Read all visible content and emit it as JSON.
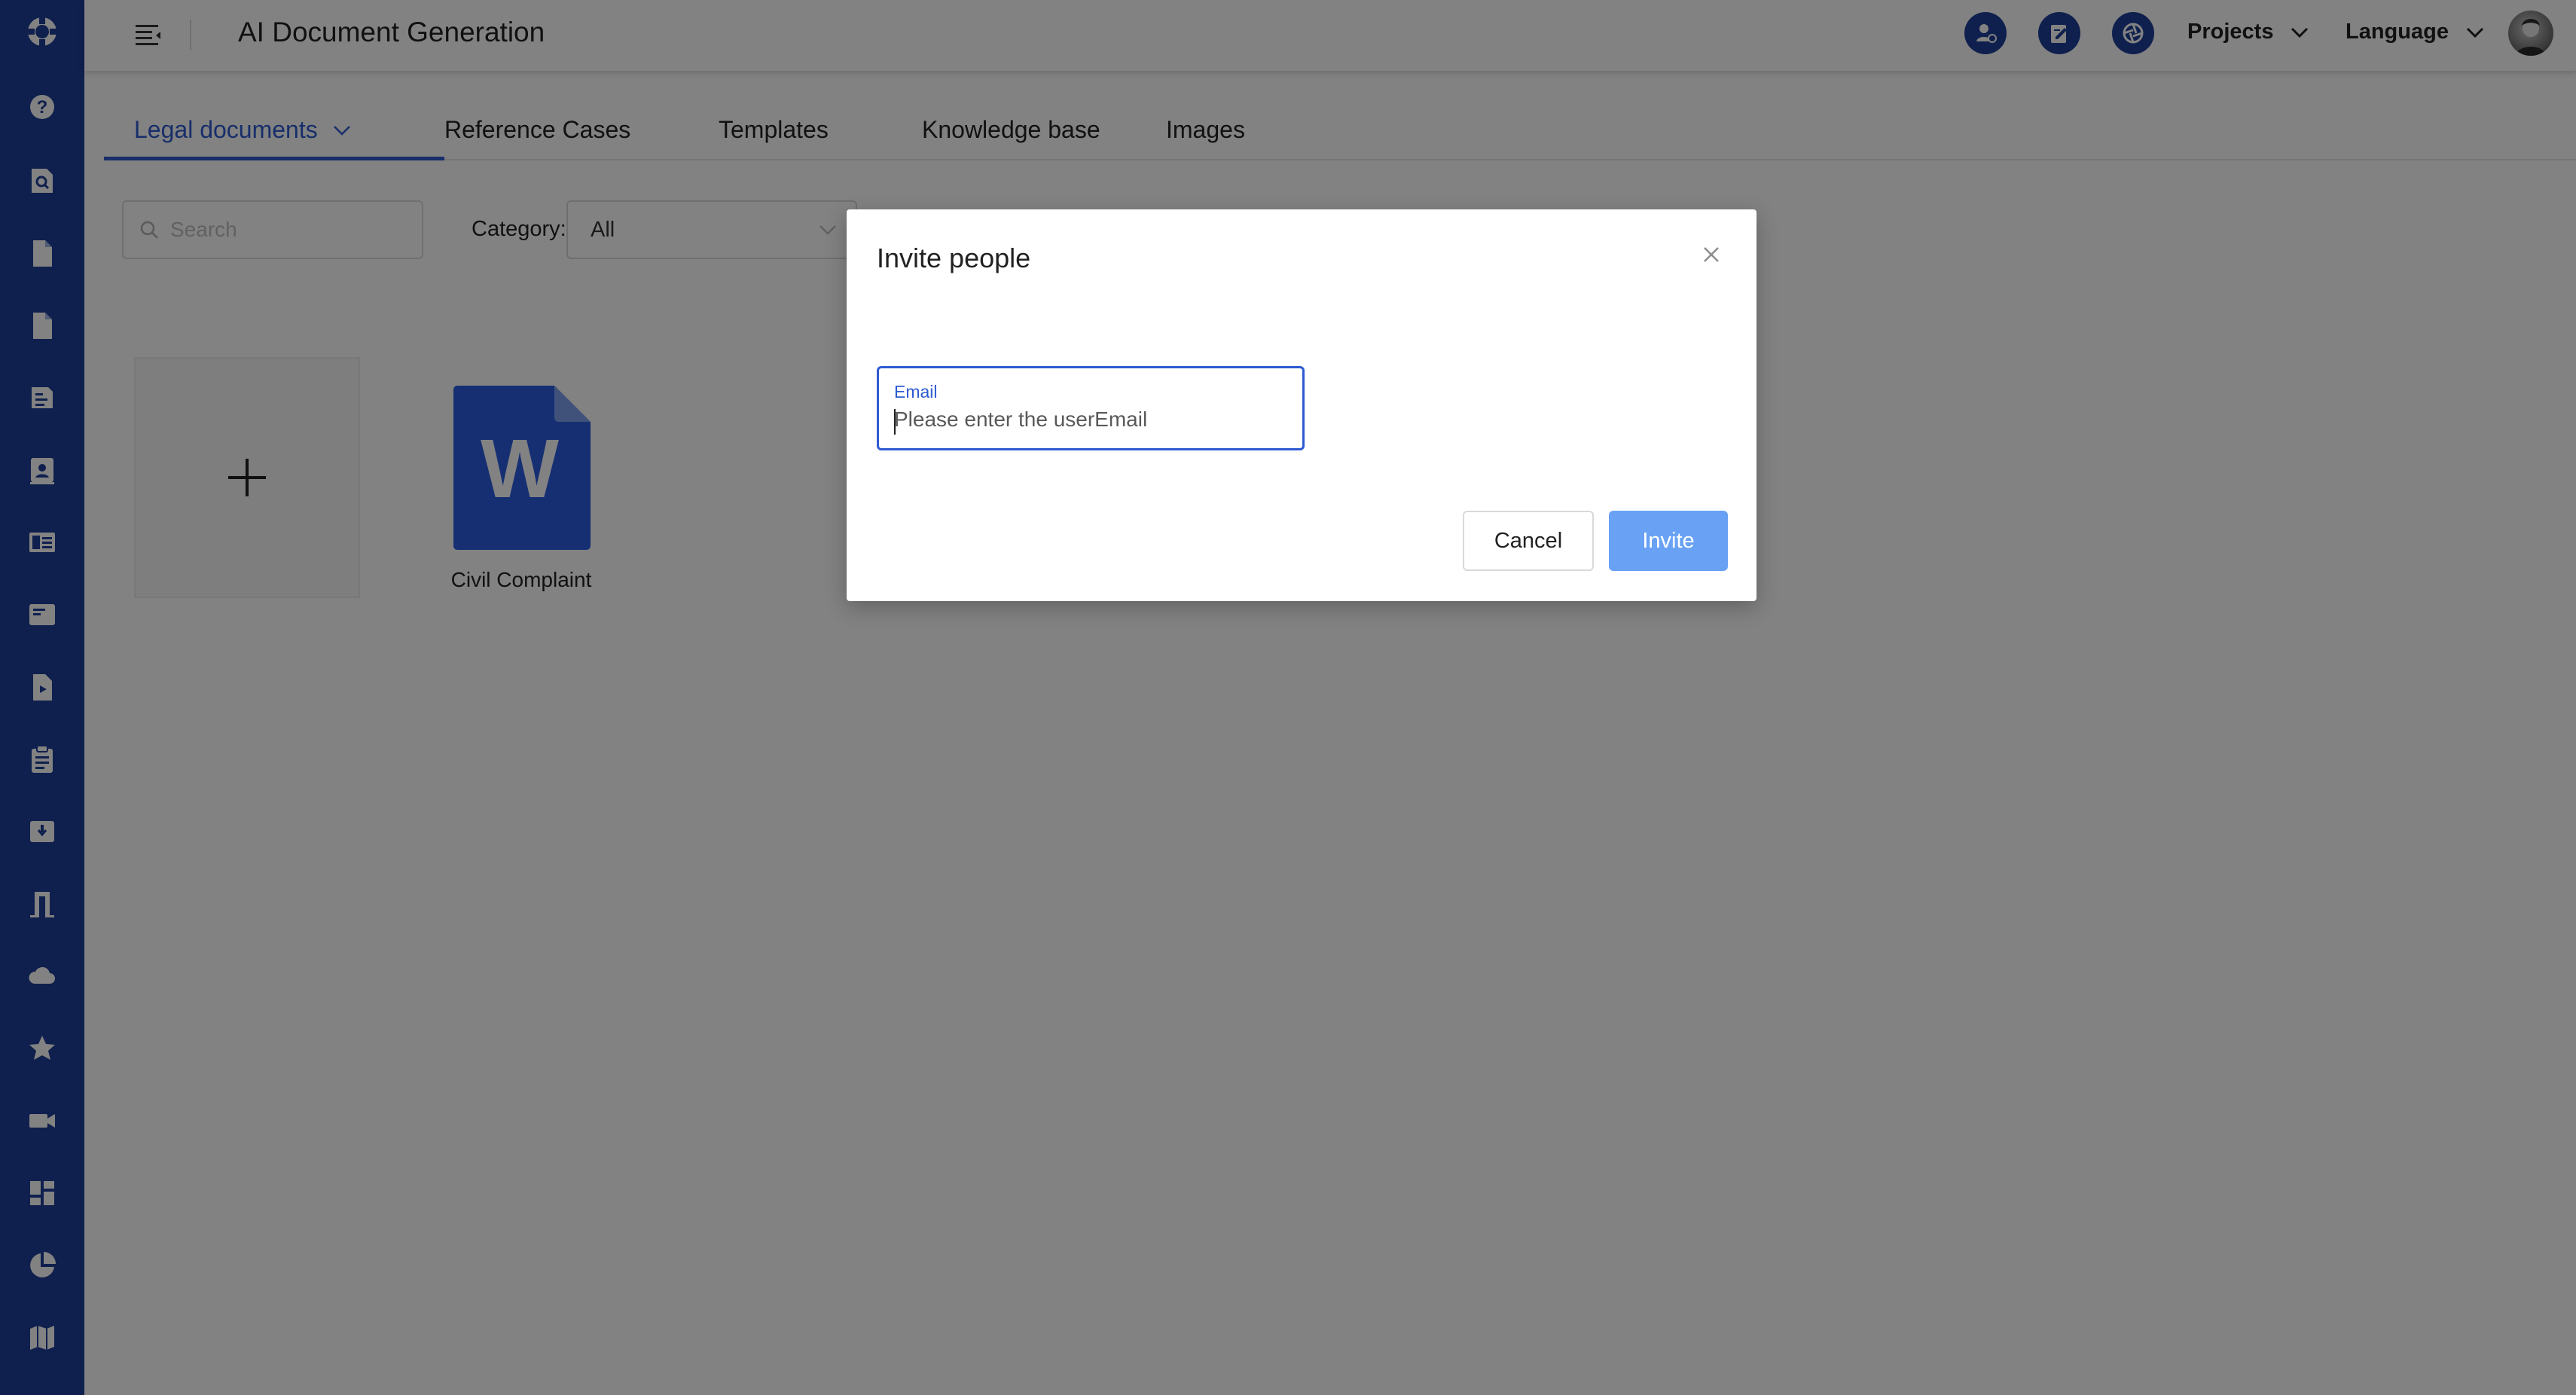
{
  "app": {
    "title": "AI Document Generation",
    "brand_color": "#1e3f9a",
    "accent_color": "#2d5bd1"
  },
  "sidebar": {
    "items": [
      {
        "icon": "lifebuoy-logo-icon"
      },
      {
        "icon": "help-icon"
      },
      {
        "icon": "document-search-icon"
      },
      {
        "icon": "document-icon"
      },
      {
        "icon": "document-alt-icon"
      },
      {
        "icon": "report-document-icon"
      },
      {
        "icon": "contact-card-icon"
      },
      {
        "icon": "list-card-icon"
      },
      {
        "icon": "article-icon"
      },
      {
        "icon": "file-play-icon"
      },
      {
        "icon": "clipboard-icon"
      },
      {
        "icon": "archive-box-icon"
      },
      {
        "icon": "exit-door-icon"
      },
      {
        "icon": "cloud-icon"
      },
      {
        "icon": "star-icon"
      },
      {
        "icon": "video-camera-icon"
      },
      {
        "icon": "dashboard-icon"
      },
      {
        "icon": "pie-chart-icon"
      },
      {
        "icon": "map-icon"
      }
    ]
  },
  "header": {
    "menu_icon": "menu-fold-icon",
    "actions": [
      {
        "icon": "user-settings-icon"
      },
      {
        "icon": "edit-note-icon"
      },
      {
        "icon": "shutter-icon"
      }
    ],
    "projects_label": "Projects",
    "language_label": "Language"
  },
  "tabs": [
    {
      "label": "Legal documents",
      "active": true
    },
    {
      "label": "Reference Cases"
    },
    {
      "label": "Templates"
    },
    {
      "label": "Knowledge base"
    },
    {
      "label": "Images"
    }
  ],
  "filters": {
    "search_placeholder": "Search",
    "category_label": "Category:",
    "category_value": "All"
  },
  "documents": [
    {
      "name": "Civil Complaint",
      "type": "word",
      "icon_letter": "W"
    }
  ],
  "modal": {
    "title": "Invite people",
    "email_label": "Email",
    "email_placeholder": "Please enter the userEmail",
    "email_value": "",
    "cancel_label": "Cancel",
    "invite_label": "Invite",
    "invite_color": "#69a2f5"
  }
}
